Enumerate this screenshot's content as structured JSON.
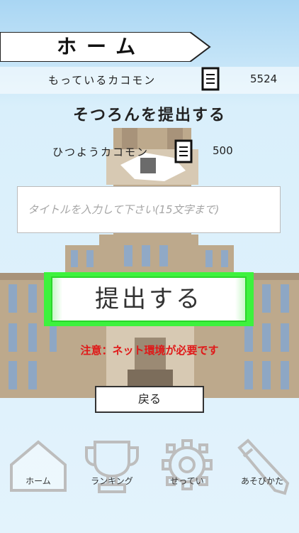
{
  "header": {
    "title": "ホーム"
  },
  "coins": {
    "label": "もっているカコモン",
    "value": "5524"
  },
  "submit": {
    "heading": "そつろんを提出する",
    "required_label": "ひつようカコモン",
    "required_value": "500",
    "title_placeholder": "タイトルを入力して下さい(15文字まで)",
    "submit_label": "提出する",
    "warning": "注意：ネット環境が必要です",
    "back_label": "戻る"
  },
  "nav": {
    "items": [
      {
        "label": "ホーム",
        "icon": "home-icon"
      },
      {
        "label": "ランキング",
        "icon": "trophy-icon"
      },
      {
        "label": "せってい",
        "icon": "gear-icon"
      },
      {
        "label": "あそびかた",
        "icon": "pencil-icon"
      }
    ]
  },
  "colors": {
    "accent": "#3df23d",
    "warning": "#e01818",
    "sky": "#a9d6f3"
  }
}
